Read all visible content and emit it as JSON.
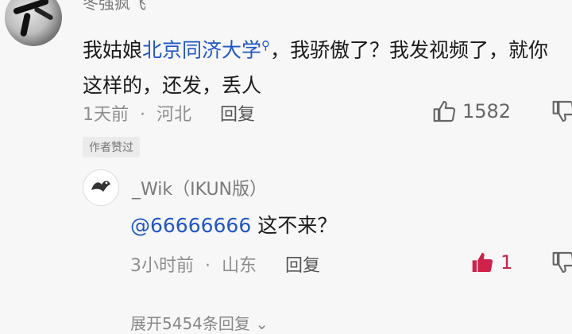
{
  "top_comment": {
    "username": "冬强疯飞",
    "text_prefix": "我姑娘",
    "school_link": "北京同济大学",
    "text_rest": "，我骄傲了？我发视频了，就你这样的，还发，丢人",
    "time": "1天前",
    "location": "河北",
    "reply_label": "回复",
    "like_count": "1582",
    "author_badge": "作者赞过"
  },
  "reply": {
    "username": "_Wik（IKUN版）",
    "mention": "@66666666",
    "text": " 这不来？",
    "time": "3小时前",
    "location": "山东",
    "reply_label": "回复",
    "like_count": "1"
  },
  "expand_label": "展开5454条回复",
  "colors": {
    "link": "#1f56c9",
    "liked": "#d0214b"
  },
  "icons": [
    "search-icon",
    "like-icon",
    "dislike-icon",
    "liked-icon",
    "chevron-down-icon"
  ]
}
